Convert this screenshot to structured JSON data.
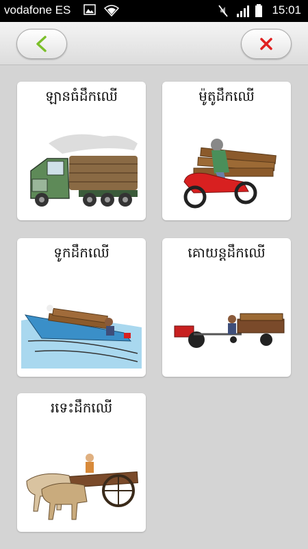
{
  "status_bar": {
    "carrier": "vodafone ES",
    "time": "15:01"
  },
  "toolbar": {
    "back_icon": "chevron-left-icon",
    "close_icon": "close-x-icon",
    "back_color": "#7bbf2a",
    "close_color": "#e02020"
  },
  "cards": [
    {
      "label": "ឡានធំដឹកឈើ",
      "icon": "logging-truck"
    },
    {
      "label": "ម៉ូតូដឹកឈើ",
      "icon": "motorbike-with-timber"
    },
    {
      "label": "ទូកដឹកឈើ",
      "icon": "boat-with-timber"
    },
    {
      "label": "គោយន្តដឹកឈើ",
      "icon": "tractor-trailer-with-timber"
    },
    {
      "label": "រទេះដឹកឈើ",
      "icon": "ox-cart-with-timber"
    }
  ]
}
